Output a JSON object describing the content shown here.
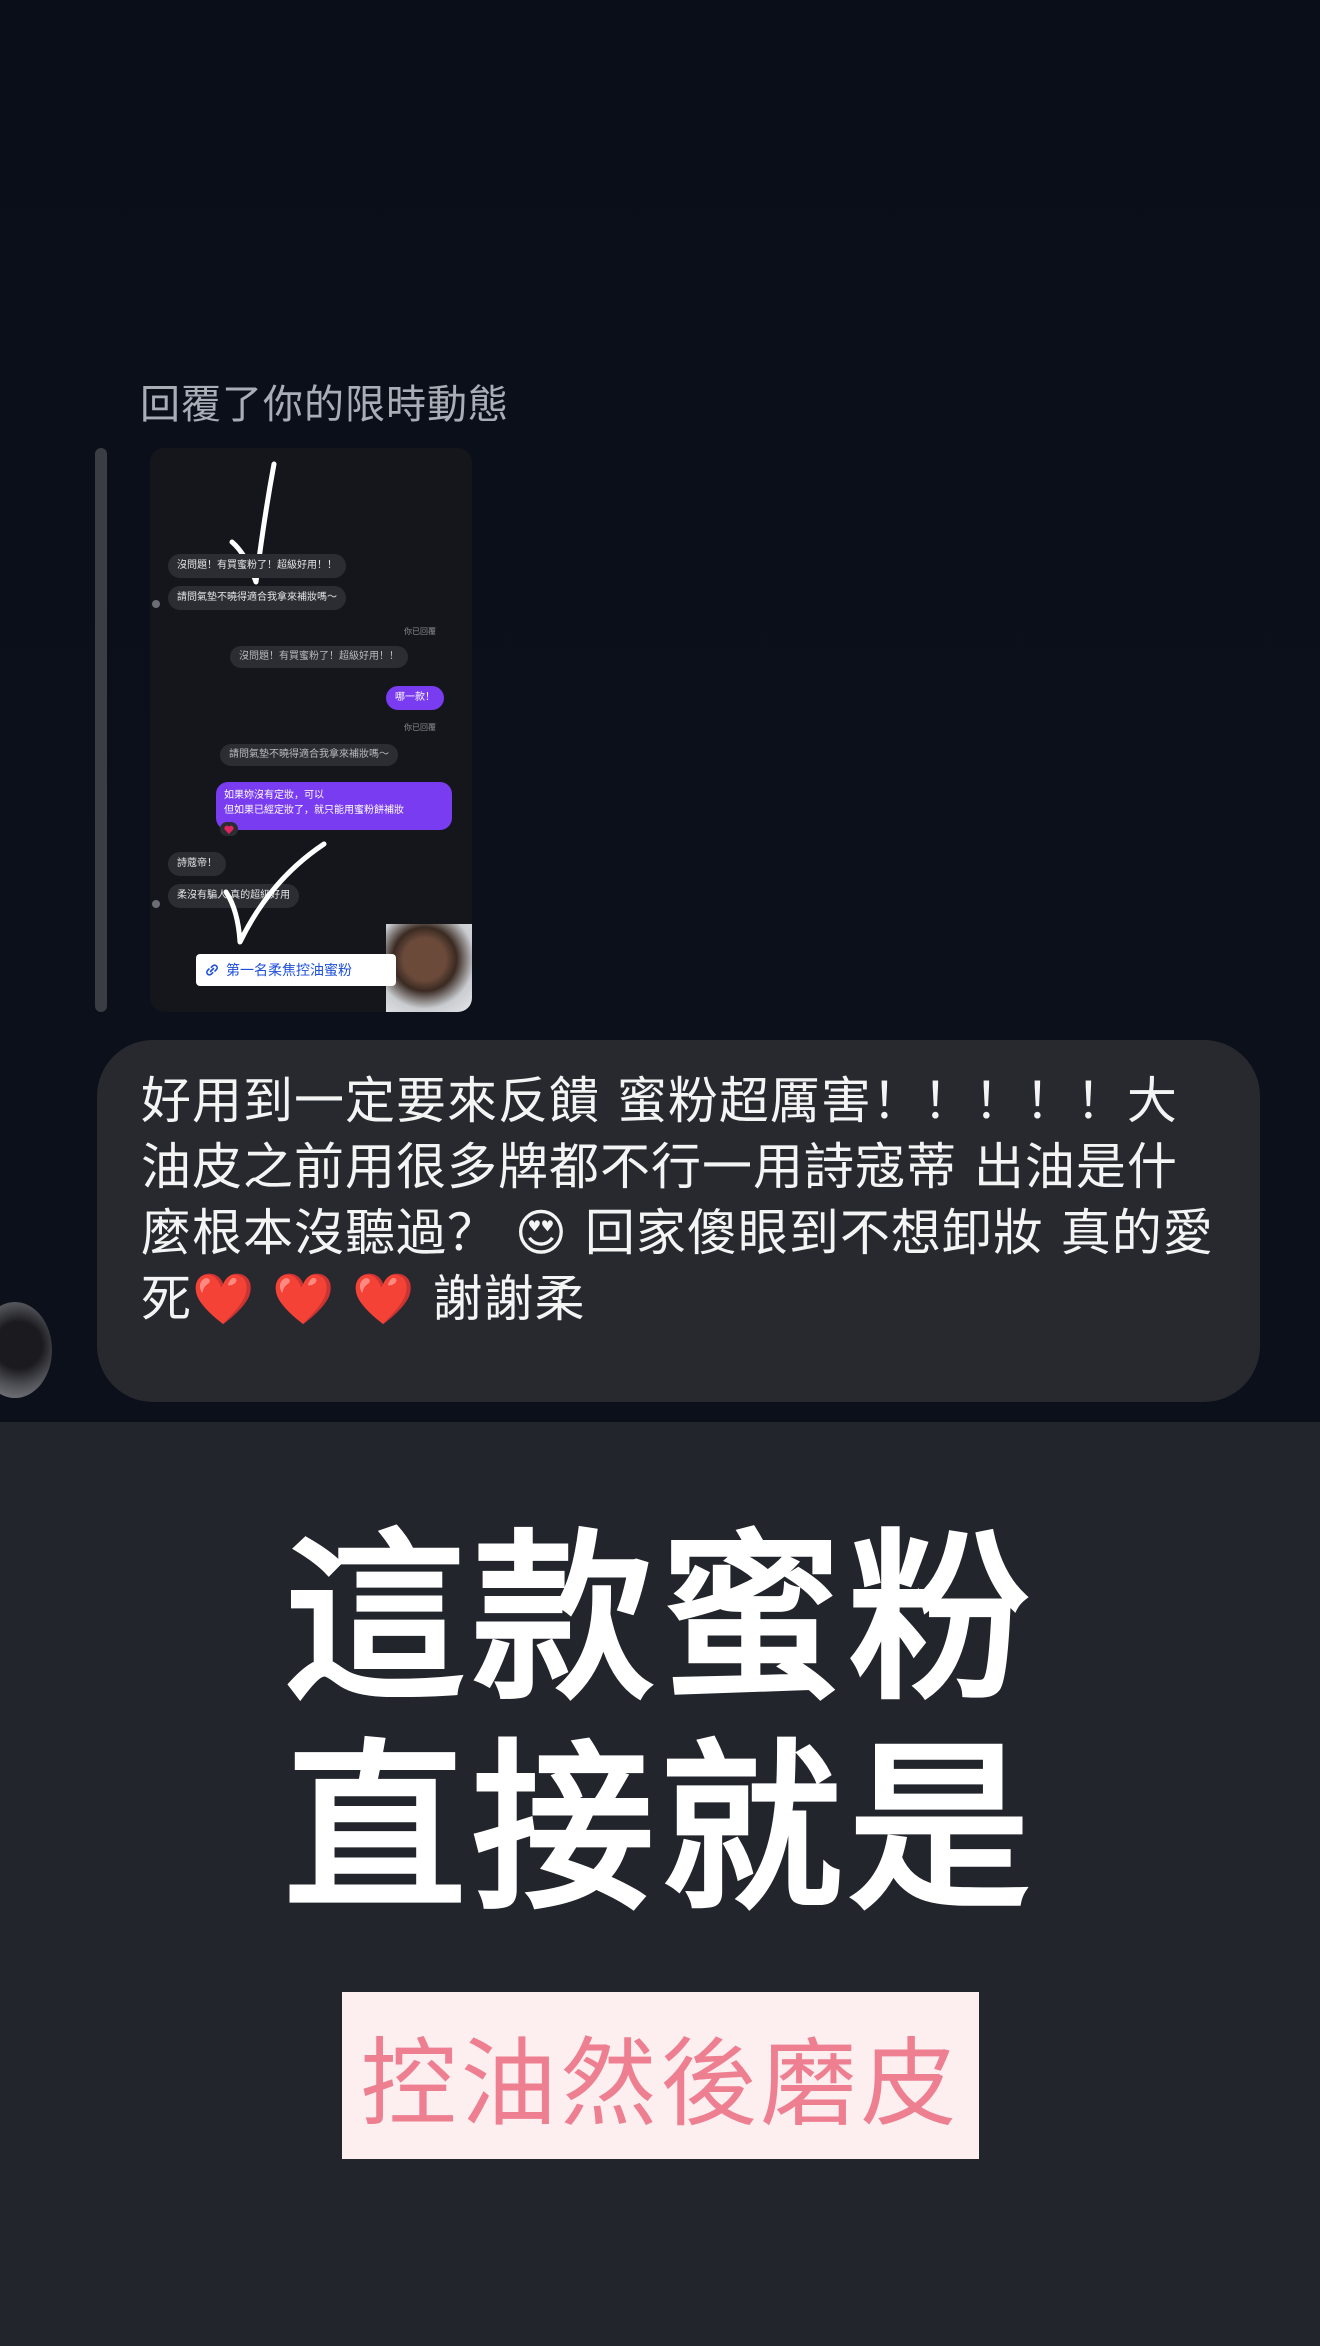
{
  "reply": {
    "caption": "回覆了你的限時動態"
  },
  "story": {
    "bubbles": [
      "沒問題！有買蜜粉了！超級好用！！",
      "請問氣墊不曉得適合我拿來補妝嗎～",
      "你已回覆",
      "沒問題！有買蜜粉了！超級好用！！",
      "哪一款！",
      "你已回覆",
      "請問氣墊不曉得適合我拿來補妝嗎～",
      "如果妳沒有定妝，可以",
      "但如果已經定妝了，就只能用蜜粉餅補妝",
      "詩蔻帝！",
      "柔沒有騙人 真的超級好用"
    ],
    "link_label": "第一名柔焦控油蜜粉"
  },
  "message": {
    "text": "好用到一定要來反饋 蜜粉超厲害！！！！！大油皮之前用很多牌都不行一用詩寇蒂 出油是什麼根本沒聽過？ 😍 回家傻眼到不想卸妝 真的愛死❤️ ❤️ ❤️ 謝謝柔"
  },
  "caption": {
    "line1": "這款蜜粉",
    "line2": "直接就是",
    "highlight": "控油然後磨皮"
  },
  "colors": {
    "background_dark": "#0b0f19",
    "bubble": "#27292f",
    "lower_panel": "#22252b",
    "accent_purple": "#7a3cf0",
    "highlight_box": "#fdeef0",
    "highlight_text": "#ee7f91"
  }
}
